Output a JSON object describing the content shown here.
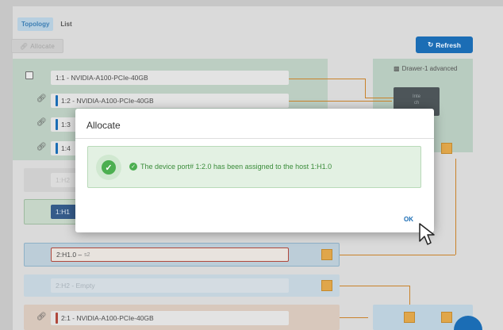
{
  "tabs": [
    {
      "label": "Topology",
      "active": true
    },
    {
      "label": "List",
      "active": false
    }
  ],
  "toolbar": {
    "allocate_label": "Allocate",
    "refresh_label": "Refresh"
  },
  "drawer": {
    "title": "Drawer-1 advanced",
    "chip_text": "Inte\nch"
  },
  "devices": [
    {
      "label": "1:1 - NVIDIA-A100-PCIe-40GB",
      "state": "unallocated"
    },
    {
      "label": "1:2 - NVIDIA-A100-PCIe-40GB",
      "state": "linked"
    },
    {
      "label": "1:3",
      "state": "linked"
    },
    {
      "label": "1:4",
      "state": "linked"
    }
  ],
  "hosts": [
    {
      "label": "1:H2"
    },
    {
      "label": "1:H1"
    },
    {
      "label": "2:H1.0 –",
      "suffix": "s2"
    },
    {
      "label": "2:H2 - Empty"
    }
  ],
  "devices2": [
    {
      "label": "2:1 - NVIDIA-A100-PCIe-40GB",
      "state": "linked"
    }
  ],
  "dialog": {
    "title": "Allocate",
    "message": "The device port# 1:2.0 has been assigned to the host 1:H1.0",
    "ok_label": "OK"
  },
  "colors": {
    "accent": "#1b6db5",
    "success": "#4caf50",
    "port": "#e0a64a"
  }
}
